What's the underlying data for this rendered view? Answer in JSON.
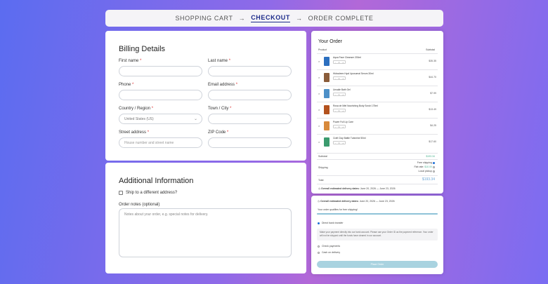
{
  "steps": {
    "cart": "SHOPPING CART",
    "checkout": "CHECKOUT",
    "complete": "ORDER COMPLETE",
    "arrow": "→"
  },
  "billing": {
    "title": "Billing Details",
    "first_name": "First name",
    "last_name": "Last name",
    "phone": "Phone",
    "email": "Email address",
    "country": "Country / Region",
    "country_value": "United States (US)",
    "town": "Town / City",
    "street": "Street address",
    "street_placeholder": "House number and street name",
    "zip": "ZIP Code",
    "req": "*"
  },
  "additional": {
    "title": "Additional Information",
    "ship_label": "Ship to a different address?",
    "notes_label": "Order notes (optional)",
    "notes_placeholder": "Notes about your order, e.g. special notes for delivery."
  },
  "order": {
    "title": "Your Order",
    "col_product": "Product",
    "col_subtotal": "Subtotal",
    "items": [
      {
        "name": "Aqua Face Cleanser 200ml",
        "price": "$35.35",
        "color": "#2c6fbf"
      },
      {
        "name": "Hidradrem Hyal Liposomal Serum 30ml",
        "price": "$44.70",
        "color": "#8a5c3a"
      },
      {
        "name": "Unsalle Bath Gel",
        "price": "$7.99",
        "color": "#4d90c8"
      },
      {
        "name": "Rosa de Miel Nourishing Body Scrub 175ml",
        "price": "$13.49",
        "color": "#b3521e"
      },
      {
        "name": "Power Full Lip Care",
        "price": "$4.25",
        "color": "#d88a3c"
      },
      {
        "name": "Craft Clay Battle Turkmine 50ml",
        "price": "$17.60",
        "color": "#3b9b6e"
      }
    ],
    "subtotal_label": "Subtotal",
    "subtotal_value": "$193.34",
    "shipping_label": "Shipping",
    "ship_options": [
      {
        "label": "Free shipping",
        "value": ""
      },
      {
        "label": "Flat rate:",
        "value": "$10.00"
      },
      {
        "label": "Local pickup",
        "value": ""
      }
    ],
    "total_label": "Total",
    "total_value": "$193.34",
    "delivery_label": "Overall estimated delivery dates:",
    "delivery_value": "June 20, 2026 — June 23, 2026"
  },
  "payment": {
    "delivery_label": "Overall estimated delivery dates:",
    "delivery_value": "June 20, 2026 — June 23, 2026",
    "free_ship_note": "Your order qualifies for free shipping!",
    "free_ship_progress": 1.0,
    "method_bank": "Direct bank transfer",
    "bank_desc": "Make your payment directly into our bank account. Please use your Order ID as the payment reference. Your order will not be shipped until the funds have cleared in our account.",
    "method_check": "Check payments",
    "method_cod": "Cash on delivery",
    "place_order": "Place Order"
  },
  "colors": {
    "accent": "#1b2a8a",
    "button": "#a9d3e0",
    "price_green": "#48b28e"
  }
}
